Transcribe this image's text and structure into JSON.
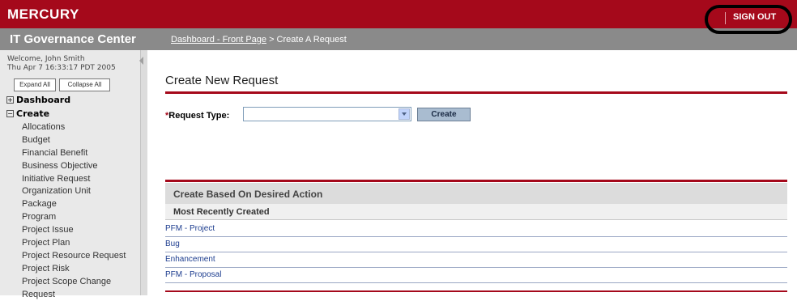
{
  "header": {
    "logo": "MERCURY",
    "sign_out": "SIGN OUT"
  },
  "subheader": {
    "app_title": "IT Governance Center",
    "breadcrumb_link": "Dashboard - Front Page",
    "breadcrumb_current": " > Create A Request"
  },
  "sidebar": {
    "welcome_line1": "Welcome, John Smith",
    "welcome_line2": "Thu Apr 7 16:33:17 PDT 2005",
    "expand_all": "Expand All",
    "collapse_all": "Collapse All",
    "dashboard": "Dashboard",
    "create": "Create",
    "items": [
      {
        "label": "Allocations"
      },
      {
        "label": "Budget"
      },
      {
        "label": "Financial Benefit"
      },
      {
        "label": "Business Objective"
      },
      {
        "label": "Initiative Request"
      },
      {
        "label": "Organization Unit"
      },
      {
        "label": "Package"
      },
      {
        "label": "Program"
      },
      {
        "label": "Project Issue"
      },
      {
        "label": "Project Plan"
      },
      {
        "label": "Project Resource Request"
      },
      {
        "label": "Project Risk"
      },
      {
        "label": "Project Scope Change"
      },
      {
        "label": "Request"
      }
    ]
  },
  "main": {
    "title": "Create New Request",
    "request_type_label": "Request Type:",
    "request_type_value": "",
    "create_button": "Create",
    "section_title": "Create Based On Desired Action",
    "subsection_title": "Most Recently Created",
    "recent": [
      {
        "label": "PFM - Project"
      },
      {
        "label": "Bug"
      },
      {
        "label": "Enhancement"
      },
      {
        "label": "PFM - Proposal"
      }
    ]
  },
  "colors": {
    "brand_red": "#a5091b",
    "subbar_gray": "#8a8a8a",
    "link_blue": "#1d3d8f"
  }
}
